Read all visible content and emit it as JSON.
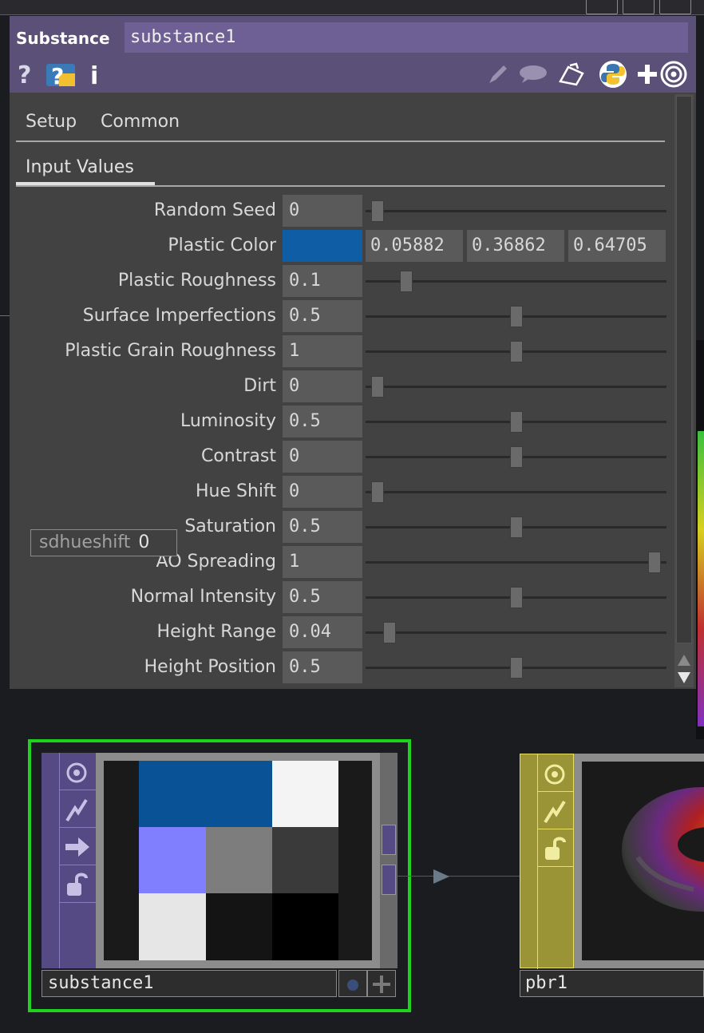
{
  "panel": {
    "op_type": "Substance",
    "op_name": "substance1",
    "tabs": [
      {
        "label": "Setup"
      },
      {
        "label": "Common"
      }
    ],
    "subtabs": [
      {
        "label": "Input Values",
        "active": true
      }
    ],
    "params": [
      {
        "label": "Random Seed",
        "value": "0",
        "slider": 0.02
      },
      {
        "label": "Plastic Roughness",
        "value": "0.1",
        "slider": 0.12
      },
      {
        "label": "Surface Imperfections",
        "value": "0.5",
        "slider": 0.5
      },
      {
        "label": "Plastic Grain Roughness",
        "value": "1",
        "slider": 0.5
      },
      {
        "label": "Dirt",
        "value": "0",
        "slider": 0.02
      },
      {
        "label": "Luminosity",
        "value": "0.5",
        "slider": 0.5
      },
      {
        "label": "Contrast",
        "value": "0",
        "slider": 0.5
      },
      {
        "label": "Hue Shift",
        "value": "0",
        "slider": 0.02
      },
      {
        "label": "Saturation",
        "value": "0.5",
        "slider": 0.5
      },
      {
        "label": "AO Spreading",
        "value": "1",
        "slider": 0.98
      },
      {
        "label": "Normal Intensity",
        "value": "0.5",
        "slider": 0.5
      },
      {
        "label": "Height Range",
        "value": "0.04",
        "slider": 0.06
      },
      {
        "label": "Height Position",
        "value": "0.5",
        "slider": 0.5
      }
    ],
    "plastic_color": {
      "label": "Plastic Color",
      "r": "0.05882",
      "g": "0.36862",
      "b": "0.64705",
      "swatch": "#0f5ea5"
    },
    "tooltip": {
      "name": "sdhueshift",
      "value": "0"
    },
    "header_icons": [
      "help-icon",
      "python-help-icon",
      "info-icon",
      "pencil-icon",
      "comment-icon",
      "clipboard-icon",
      "python-icon",
      "plus-icon",
      "viewer-target-icon"
    ]
  },
  "network": {
    "node1": {
      "name": "substance1",
      "selected": true,
      "border_color": "#1ed21e",
      "side_color": "#564a84"
    },
    "node2": {
      "name": "pbr1",
      "side_color": "#9a9436"
    }
  }
}
